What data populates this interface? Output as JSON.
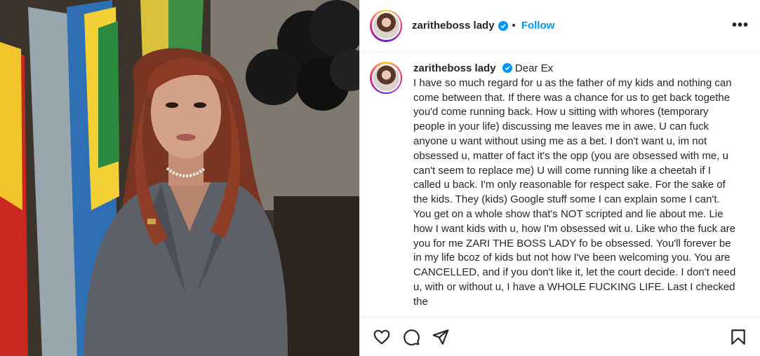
{
  "post": {
    "username": "zaritheBOSSlady",
    "username_display": "zaritheboss lady",
    "follow_label": "Follow",
    "separator": "•",
    "more_label": "•••"
  },
  "caption": {
    "username": "zaritheboss lady",
    "title": "Dear Ex",
    "body": "I have so much regard for u as the father of my kids and nothing can come between that. If there was a chance for us to get back togethe you'd come running back. How u sitting with whores (temporary people in your life) discussing me leaves me in awe. U can fuck anyone u want without using me as a bet. I don't want u, im not obsessed u, matter of fact it's the opp (you are obsessed with me, u can't seem to replace me) U will come running like a cheetah if I called u back. I'm only reasonable for respect sake. For the sake of the kids. They (kids) Google stuff some I can explain some I can't. You get on a whole show that's NOT scripted and lie about me. Lie how I want kids with u, how I'm obsessed wit u. Like who the fuck are you for me ZARI THE BOSS LADY fo be obsessed. You'll forever be in my life bcoz of kids but not how I've been welcoming you. You are CANCELLED, and if you don't like it, let the court decide. I don't need u, with or without u, I have a WHOLE FUCKING LIFE. Last I checked the"
  },
  "icons": [
    "heart-icon",
    "comment-icon",
    "share-icon",
    "bookmark-icon",
    "verified-badge-icon"
  ],
  "colors": {
    "accent": "#0095f6",
    "text": "#262626",
    "border": "#efefef"
  }
}
